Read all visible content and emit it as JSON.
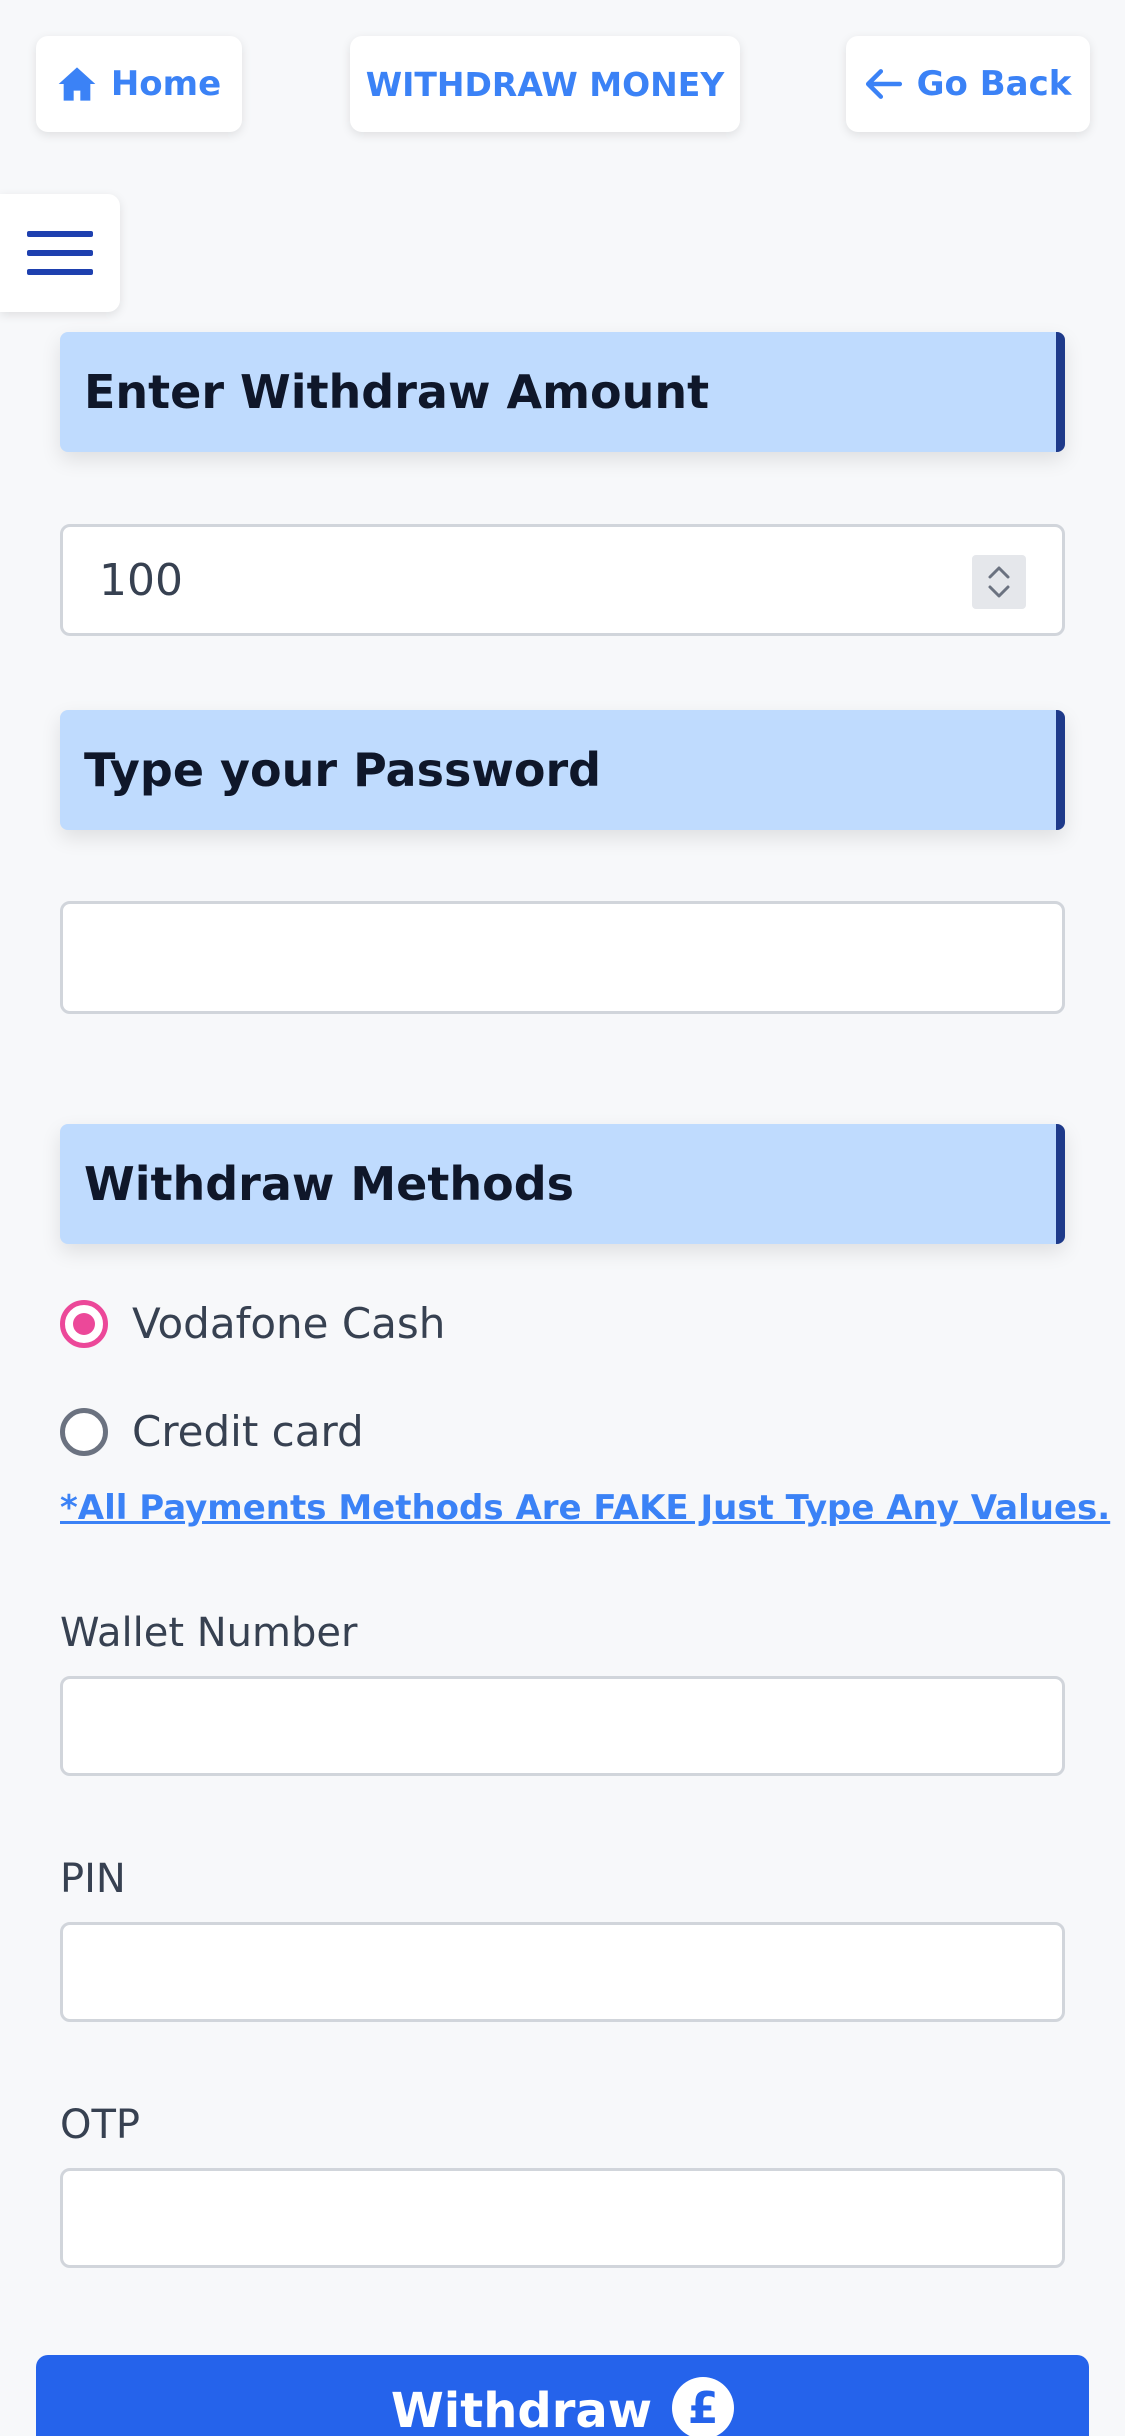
{
  "header": {
    "home_label": "Home",
    "title": "WITHDRAW MONEY",
    "back_label": "Go Back"
  },
  "sections": {
    "amount_title": "Enter Withdraw Amount",
    "password_title": "Type your Password",
    "methods_title": "Withdraw Methods"
  },
  "form": {
    "amount_value": "100",
    "password_value": ""
  },
  "methods": {
    "options": [
      {
        "label": "Vodafone Cash",
        "selected": true
      },
      {
        "label": "Credit card",
        "selected": false
      }
    ],
    "disclaimer": "*All Payments Methods Are FAKE Just Type Any Values."
  },
  "wallet": {
    "number_label": "Wallet Number",
    "pin_label": "PIN",
    "otp_label": "OTP"
  },
  "submit": {
    "label": "Withdraw",
    "currency_symbol": "£"
  },
  "colors": {
    "accent": "#3b82f6",
    "primary_button": "#2563eb",
    "section_bg": "#bfdbfe",
    "section_border": "#1e3a8a",
    "radio_selected": "#ec4899"
  }
}
